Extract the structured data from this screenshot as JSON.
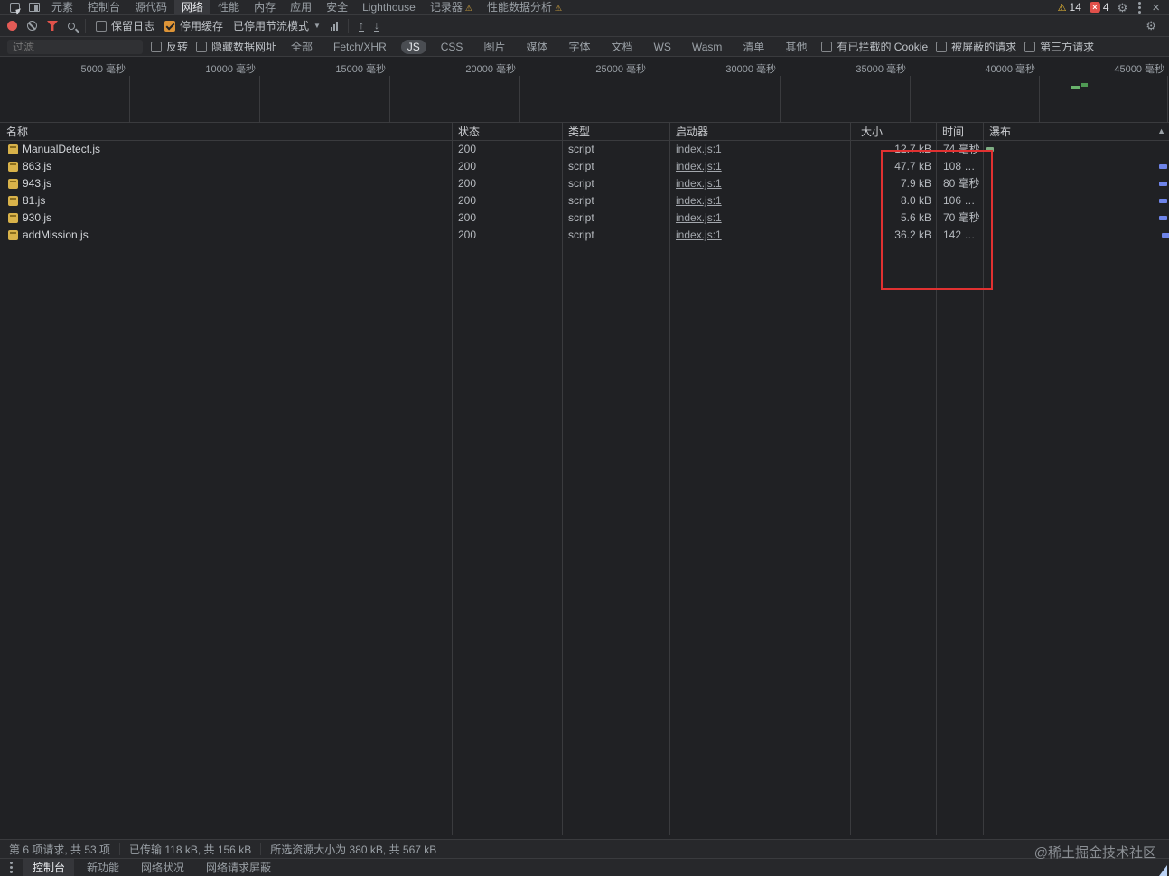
{
  "tabbar": {
    "tabs": [
      {
        "label": "元素"
      },
      {
        "label": "控制台"
      },
      {
        "label": "源代码"
      },
      {
        "label": "网络",
        "selected": true
      },
      {
        "label": "性能"
      },
      {
        "label": "内存"
      },
      {
        "label": "应用"
      },
      {
        "label": "安全"
      },
      {
        "label": "Lighthouse"
      },
      {
        "label": "记录器",
        "badge": "▲"
      },
      {
        "label": "性能数据分析",
        "badge": "▲"
      }
    ],
    "warning_count": "14",
    "error_count": "4"
  },
  "toolbar": {
    "preserve_log_label": "保留日志",
    "disable_cache_label": "停用缓存",
    "throttling_value": "已停用节流模式"
  },
  "filterbar": {
    "filter_placeholder": "过滤",
    "invert_label": "反转",
    "hide_data_urls_label": "隐藏数据网址",
    "type_filters": [
      "全部",
      "Fetch/XHR",
      "JS",
      "CSS",
      "图片",
      "媒体",
      "字体",
      "文档",
      "WS",
      "Wasm",
      "清单",
      "其他"
    ],
    "selected_type_filter": "JS",
    "blocked_cookies_label": "有已拦截的 Cookie",
    "blocked_requests_label": "被屏蔽的请求",
    "third_party_label": "第三方请求"
  },
  "timeline": {
    "tick_labels": [
      "5000 毫秒",
      "10000 毫秒",
      "15000 毫秒",
      "20000 毫秒",
      "25000 毫秒",
      "30000 毫秒",
      "35000 毫秒",
      "40000 毫秒",
      "45000 毫秒"
    ]
  },
  "table": {
    "columns": {
      "name": "名称",
      "status": "状态",
      "type": "类型",
      "initiator": "启动器",
      "size": "大小",
      "time": "时间",
      "waterfall": "瀑布"
    },
    "rows": [
      {
        "name": "ManualDetect.js",
        "status": "200",
        "type": "script",
        "initiator": "index.js:1",
        "size": "12.7 kB",
        "time": "74 毫秒"
      },
      {
        "name": "863.js",
        "status": "200",
        "type": "script",
        "initiator": "index.js:1",
        "size": "47.7 kB",
        "time": "108 …"
      },
      {
        "name": "943.js",
        "status": "200",
        "type": "script",
        "initiator": "index.js:1",
        "size": "7.9 kB",
        "time": "80 毫秒"
      },
      {
        "name": "81.js",
        "status": "200",
        "type": "script",
        "initiator": "index.js:1",
        "size": "8.0 kB",
        "time": "106 …"
      },
      {
        "name": "930.js",
        "status": "200",
        "type": "script",
        "initiator": "index.js:1",
        "size": "5.6 kB",
        "time": "70 毫秒"
      },
      {
        "name": "addMission.js",
        "status": "200",
        "type": "script",
        "initiator": "index.js:1",
        "size": "36.2 kB",
        "time": "142 …"
      }
    ]
  },
  "summary": {
    "requests": "第 6 项请求, 共 53 项",
    "transferred": "已传输 118 kB, 共 156 kB",
    "resources": "所选资源大小为 380 kB, 共 567 kB"
  },
  "drawer": {
    "tabs": [
      "控制台",
      "新功能",
      "网络状况",
      "网络请求屏蔽"
    ],
    "selected_tab": "控制台"
  },
  "watermark": "@稀土掘金技术社区",
  "icons": {
    "warning": "⚠",
    "dropdown": "▼",
    "scroll_up": "▲",
    "close": "×",
    "gear": "⚙",
    "import_har": "↑",
    "export_har": "↓"
  }
}
